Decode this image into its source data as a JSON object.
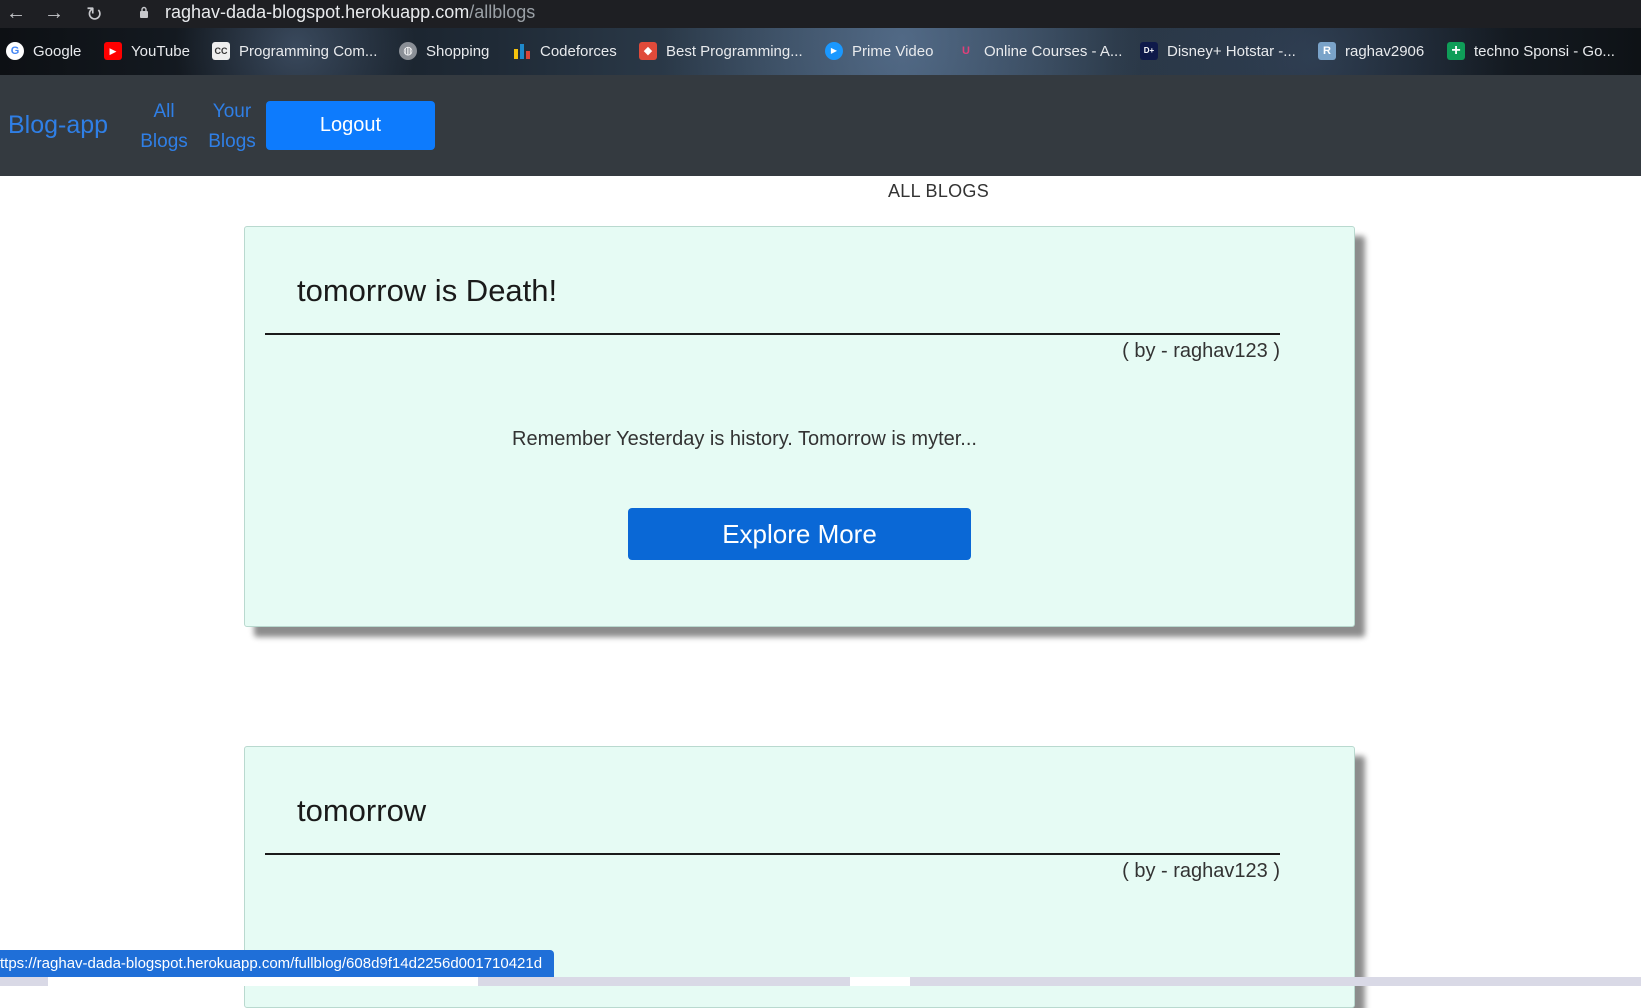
{
  "browser": {
    "url_host": "raghav-dada-blogspot.herokuapp.com",
    "url_path": "/allblogs",
    "nav": {
      "back": "←",
      "forward": "→",
      "reload": "↻"
    }
  },
  "bookmarks": [
    {
      "label": "Google",
      "icon": "google-icon",
      "color": "#ffffff",
      "glyph": "G"
    },
    {
      "label": "YouTube",
      "icon": "youtube-icon",
      "color": "#ff0000",
      "glyph": "▶"
    },
    {
      "label": "Programming Com...",
      "icon": "cc-icon",
      "color": "#6b6b6b",
      "glyph": "CC"
    },
    {
      "label": "Shopping",
      "icon": "globe-icon",
      "color": "#8a8f96",
      "glyph": "◍"
    },
    {
      "label": "Codeforces",
      "icon": "codeforces-icon",
      "color": "#1f8acb",
      "glyph": "▮"
    },
    {
      "label": "Best Programming...",
      "icon": "cube-icon",
      "color": "#e04a3a",
      "glyph": "◆"
    },
    {
      "label": "Prime Video",
      "icon": "prime-video-icon",
      "color": "#1a98ff",
      "glyph": "▶"
    },
    {
      "label": "Online Courses - A...",
      "icon": "udemy-icon",
      "color": "#a435f0",
      "glyph": "U"
    },
    {
      "label": "Disney+ Hotstar -...",
      "icon": "hotstar-icon",
      "color": "#0f1a4a",
      "glyph": "D+"
    },
    {
      "label": "raghav2906",
      "icon": "profile-icon",
      "color": "#7aa3c9",
      "glyph": "R"
    },
    {
      "label": "techno Sponsi - Go...",
      "icon": "sheets-icon",
      "color": "#0f9d58",
      "glyph": "+"
    }
  ],
  "navbar": {
    "brand": "Blog-app",
    "links": [
      {
        "line1": "All",
        "line2": "Blogs"
      },
      {
        "line1": "Your",
        "line2": "Blogs"
      }
    ],
    "logout_label": "Logout"
  },
  "page": {
    "heading": "ALL BLOGS"
  },
  "blogs": [
    {
      "title": "tomorrow is Death!",
      "author": "( by - raghav123 )",
      "snippet": "Remember Yesterday is history. Tomorrow is myter...",
      "button": "Explore More"
    },
    {
      "title": "tomorrow",
      "author": "( by - raghav123 )"
    }
  ],
  "status_bar": {
    "link_preview": "ttps://raghav-dada-blogspot.herokuapp.com/fullblog/608d9f14d2256d001710421d"
  },
  "colors": {
    "navbar_bg": "#343a40",
    "link_blue": "#2f7fe6",
    "button_blue": "#0d7bfd",
    "card_bg": "#e6fbf4"
  }
}
